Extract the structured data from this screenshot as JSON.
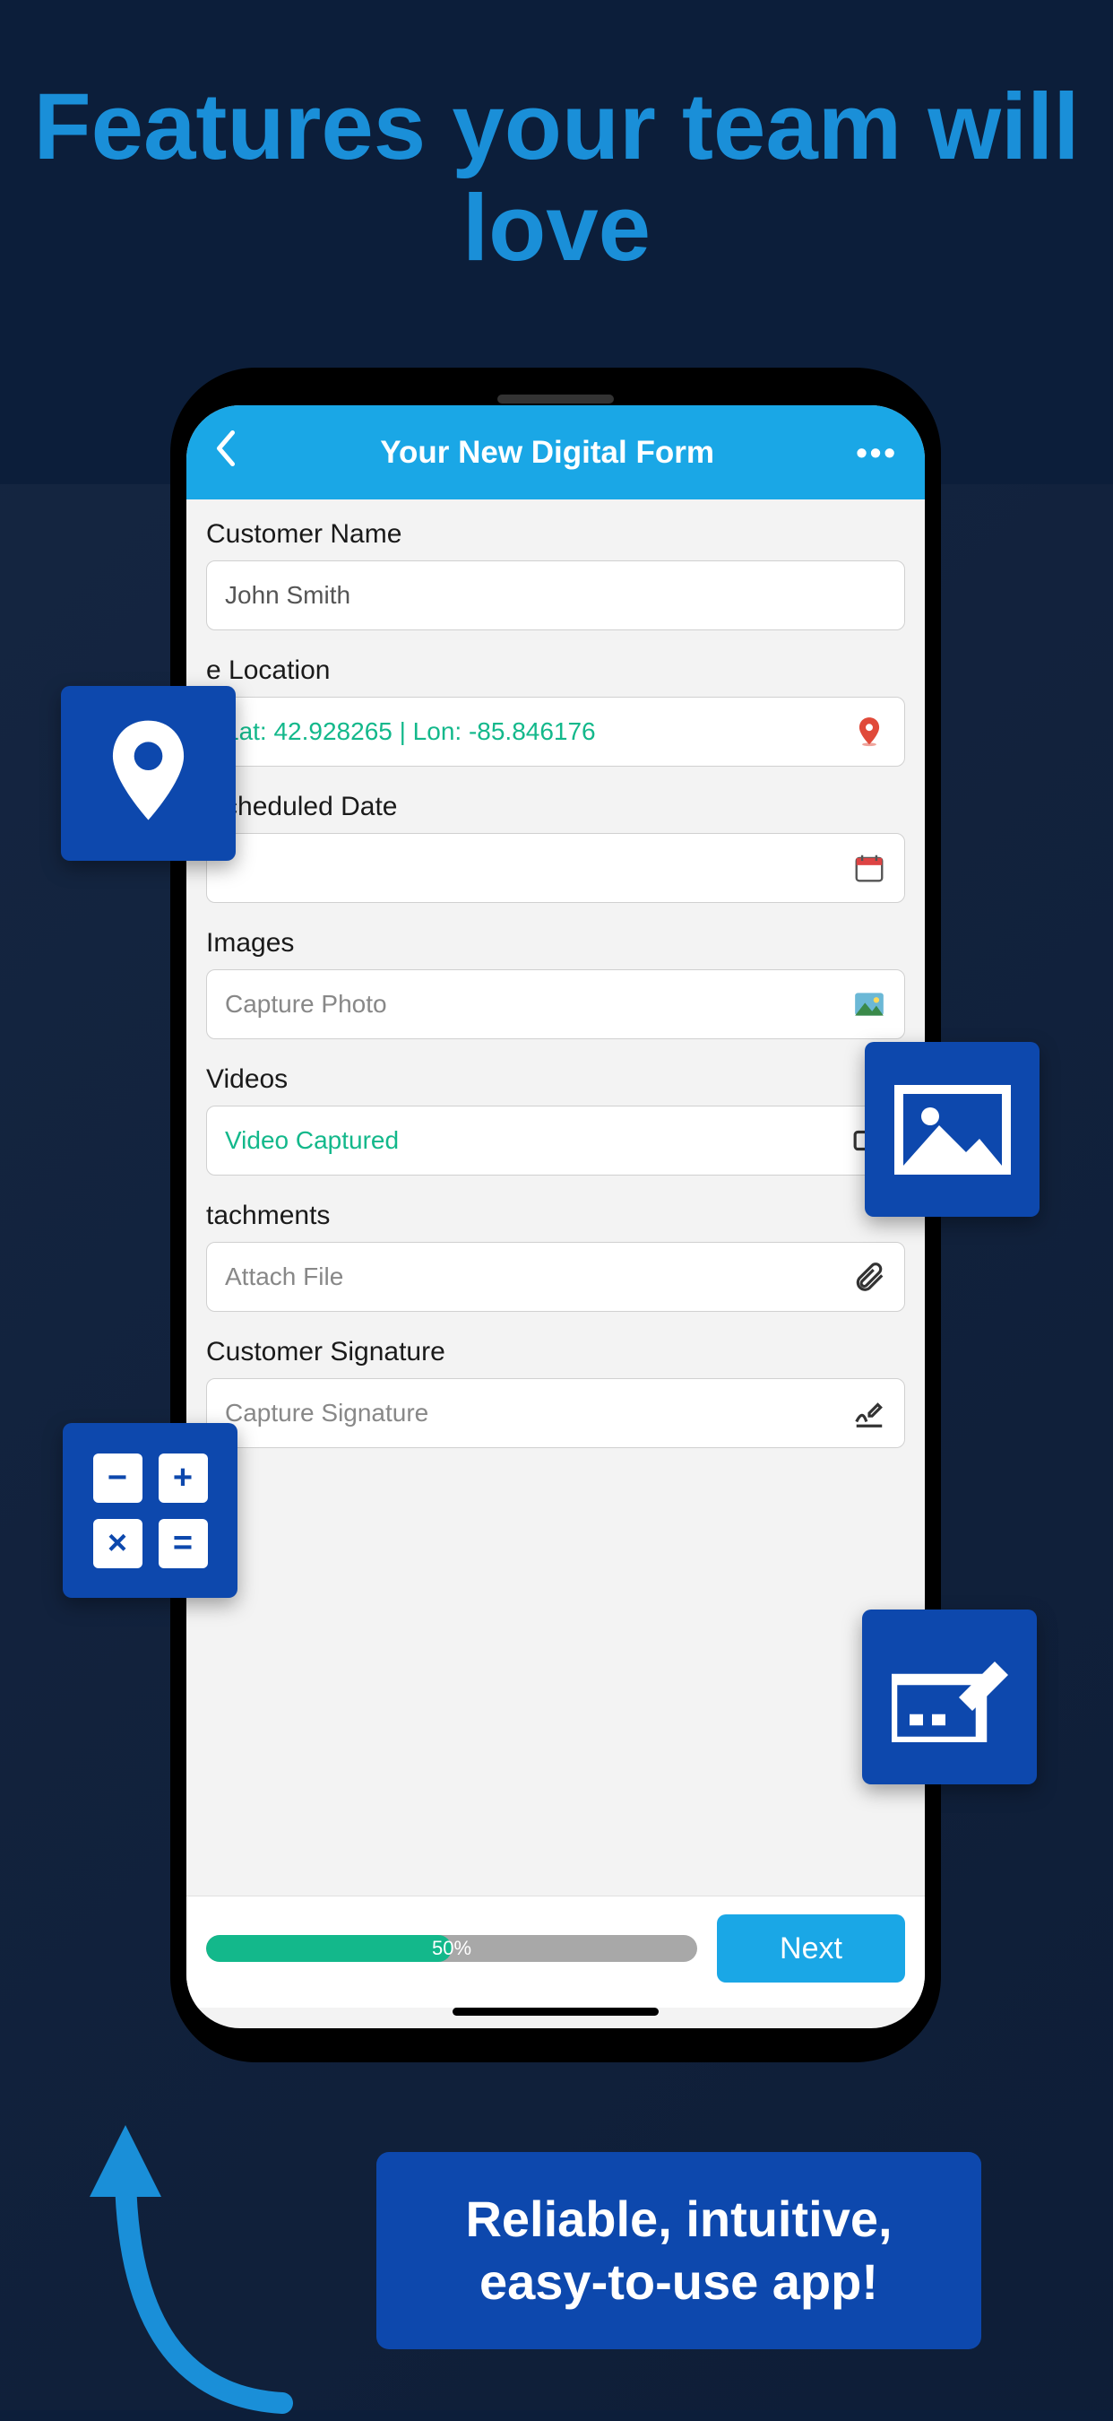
{
  "headline": "Features your team will love",
  "tagline": "Reliable, intuitive, easy-to-use app!",
  "colors": {
    "brand": "#1aa7e6",
    "accent": "#13b88b",
    "badge": "#0d48ad",
    "headline": "#1a8fd8"
  },
  "app": {
    "title": "Your New Digital Form",
    "next_label": "Next",
    "progress": {
      "percent": 50,
      "label": "50%"
    },
    "fields": {
      "customer_name": {
        "label": "Customer Name",
        "value": "John Smith"
      },
      "location": {
        "label": "e Location",
        "value": "Lat: 42.928265 | Lon: -85.846176"
      },
      "scheduled_date": {
        "label": "Scheduled Date",
        "value": ""
      },
      "images": {
        "label": "Images",
        "value": "Capture Photo"
      },
      "videos": {
        "label": "Videos",
        "value": "Video Captured"
      },
      "attachments": {
        "label": "tachments",
        "value": "Attach File"
      },
      "signature": {
        "label": "Customer Signature",
        "value": "Capture Signature"
      }
    }
  },
  "badges": [
    "location-pin",
    "image",
    "calculator",
    "signature"
  ]
}
